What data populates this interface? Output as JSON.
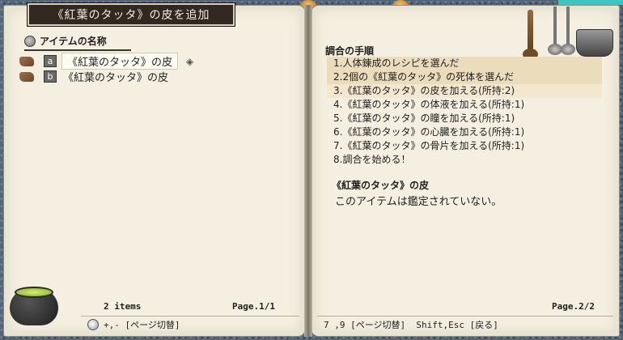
{
  "window": {
    "title": "《紅葉のタッタ》の皮を追加"
  },
  "left_page": {
    "section_heading": "アイテムの名称",
    "items": [
      {
        "key": "a",
        "label": "《紅葉のタッタ》の皮",
        "selected": true
      },
      {
        "key": "b",
        "label": "《紅葉のタッタ》の皮",
        "selected": false
      }
    ],
    "count": "2 items",
    "page": "Page.1/1",
    "hint": "+,- [ページ切替]"
  },
  "right_page": {
    "heading": "調合の手順",
    "steps": [
      {
        "text": "1.人体錬成のレシピを選んだ",
        "state": "done"
      },
      {
        "text": "2.2個の《紅葉のタッタ》の死体を選んだ",
        "state": "done"
      },
      {
        "text": "3.《紅葉のタッタ》の皮を加える(所持:2)",
        "state": "current"
      },
      {
        "text": "4.《紅葉のタッタ》の体液を加える(所持:1)",
        "state": "pending"
      },
      {
        "text": "5.《紅葉のタッタ》の瞳を加える(所持:1)",
        "state": "pending"
      },
      {
        "text": "6.《紅葉のタッタ》の心臓を加える(所持:1)",
        "state": "pending"
      },
      {
        "text": "7.《紅葉のタッタ》の骨片を加える(所持:1)",
        "state": "pending"
      },
      {
        "text": "8.調合を始める！",
        "state": "pending"
      }
    ],
    "item_name": "《紅葉のタッタ》の皮",
    "item_description": "このアイテムは鑑定されていない。",
    "page": "Page.2/2",
    "hint": "7 ,9 [ページ切替]  Shift,Esc [戻る]"
  },
  "icons": {
    "item": "hide-icon",
    "section": "bullet-icon",
    "hint": "lightbulb-icon",
    "cursor": "diamond-cursor-icon"
  },
  "colors": {
    "title_plate": "#332722",
    "paper": "#f4efe0",
    "step_done": "#ebdcbc",
    "step_current": "#f3e8cf"
  }
}
